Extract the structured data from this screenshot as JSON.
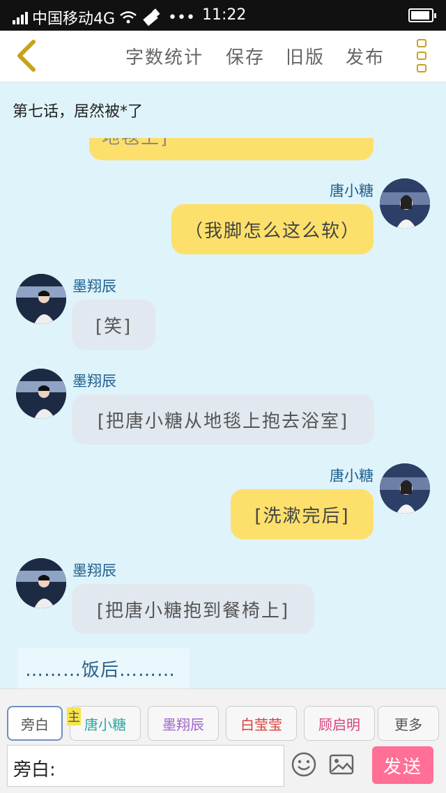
{
  "status_bar": {
    "carrier": "中国移动4G",
    "time": "11:22",
    "icons": [
      "signal-icon",
      "wifi-icon",
      "battery-icon"
    ]
  },
  "toolbar": {
    "back_icon": "chevron-left-icon",
    "word_count": "字数统计",
    "save": "保存",
    "old_version": "旧版",
    "publish": "发布",
    "menu_icon": "more-vertical-icon"
  },
  "chapter_title": "第七话，居然被*了",
  "messages": [
    {
      "side": "right",
      "name": "",
      "text": "地毯上]",
      "style": "yellow",
      "partial": true
    },
    {
      "side": "right",
      "name": "唐小糖",
      "text": "（我脚怎么这么软）",
      "style": "yellow"
    },
    {
      "side": "left",
      "name": "墨翔辰",
      "text": "[笑]",
      "style": "gray"
    },
    {
      "side": "left",
      "name": "墨翔辰",
      "text": "[把唐小糖从地毯上抱去浴室]",
      "style": "gray"
    },
    {
      "side": "right",
      "name": "唐小糖",
      "text": "[洗漱完后]",
      "style": "yellow"
    },
    {
      "side": "left",
      "name": "墨翔辰",
      "text": "[把唐小糖抱到餐椅上]",
      "style": "gray"
    }
  ],
  "narration_preview": "………饭后………",
  "characters": [
    {
      "label": "旁白",
      "color": "#555555",
      "active": true
    },
    {
      "label": "唐小糖",
      "color": "#2aa8a0",
      "main": true
    },
    {
      "label": "墨翔辰",
      "color": "#a063c8"
    },
    {
      "label": "白莹莹",
      "color": "#d8423c"
    },
    {
      "label": "顾启明",
      "color": "#d8427e"
    },
    {
      "label": "更多",
      "color": "#555555"
    }
  ],
  "main_tag": "主",
  "input": {
    "prefix": "旁白:",
    "value": ""
  },
  "emoji_icon": "emoji-icon",
  "image_icon": "image-icon",
  "send": "发送",
  "colors": {
    "accent_yellow": "#fde06b",
    "send_pink": "#ff6f96",
    "chat_bg": "#dff3fb",
    "name_blue": "#1d5f8c"
  }
}
